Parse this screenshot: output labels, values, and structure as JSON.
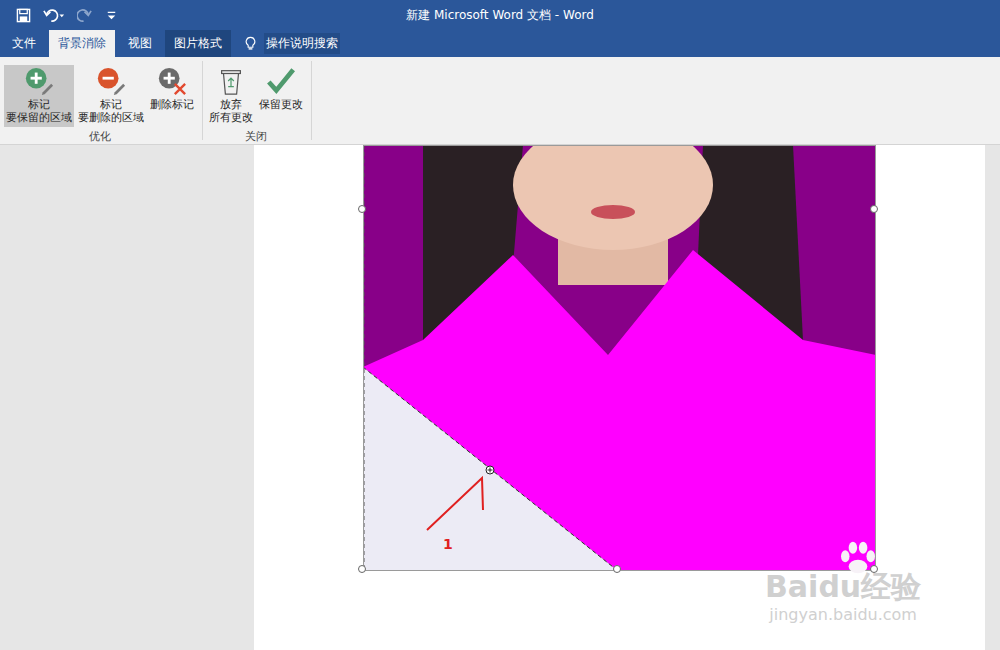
{
  "window": {
    "title": "新建 Microsoft Word 文档 - Word"
  },
  "tabs": [
    {
      "label": "文件",
      "selected": false,
      "contextual": false
    },
    {
      "label": "背景消除",
      "selected": true,
      "contextual": false
    },
    {
      "label": "视图",
      "selected": false,
      "contextual": false
    },
    {
      "label": "图片格式",
      "selected": false,
      "contextual": true
    }
  ],
  "search": {
    "label": "操作说明搜索"
  },
  "ribbon": {
    "groups": [
      {
        "label": "优化",
        "buttons": [
          {
            "kind": "keep",
            "lines": [
              "标记",
              "要保留的区域"
            ],
            "selected": true
          },
          {
            "kind": "remove",
            "lines": [
              "标记",
              "要删除的区域"
            ],
            "selected": false
          },
          {
            "kind": "delete-mark",
            "lines": [
              "删除标记"
            ],
            "selected": false
          }
        ]
      },
      {
        "label": "关闭",
        "buttons": [
          {
            "kind": "discard",
            "lines": [
              "放弃",
              "所有更改"
            ],
            "selected": false
          },
          {
            "kind": "accept",
            "lines": [
              "保留更改"
            ],
            "selected": false
          }
        ]
      }
    ]
  },
  "annotation": {
    "label": "1"
  },
  "watermark": {
    "brand": "Baidu经验",
    "url": "jingyan.baidu.com"
  }
}
